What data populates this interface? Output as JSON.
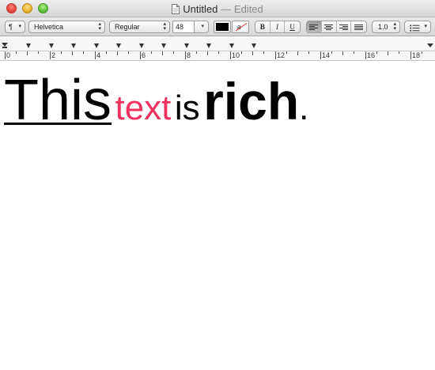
{
  "window": {
    "title": "Untitled",
    "edited": "— Edited"
  },
  "toolbar": {
    "paragraph_label": "¶",
    "font_family": "Helvetica",
    "font_style": "Regular",
    "font_size": "48",
    "text_color": "#000000",
    "background_color": "#ffffff",
    "bold_label": "B",
    "italic_label": "I",
    "underline_label": "U",
    "line_spacing": "1.0",
    "alignment_selected": "left"
  },
  "ruler": {
    "numbers": [
      "0",
      "2",
      "4",
      "6",
      "8",
      "10",
      "12",
      "14",
      "16",
      "18"
    ]
  },
  "document": {
    "words": [
      {
        "text": "This",
        "style": "underline"
      },
      {
        "text": "text",
        "color": "#f0325f"
      },
      {
        "text": "is"
      },
      {
        "text": "rich",
        "style": "bold"
      },
      {
        "text": "."
      }
    ]
  }
}
